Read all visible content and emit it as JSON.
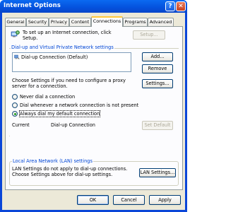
{
  "window": {
    "title": "Internet Options",
    "help_glyph": "?",
    "close_glyph": "✕"
  },
  "tabs": [
    {
      "label": "General"
    },
    {
      "label": "Security"
    },
    {
      "label": "Privacy"
    },
    {
      "label": "Content"
    },
    {
      "label": "Connections",
      "active": true
    },
    {
      "label": "Programs"
    },
    {
      "label": "Advanced"
    }
  ],
  "setup": {
    "text": "To set up an Internet connection, click Setup.",
    "text_line1": "To set up an Internet connection, click",
    "text_line2": "Setup.",
    "button": "Setup..."
  },
  "dialup": {
    "group_title": "Dial-up and Virtual Private Network settings",
    "connections": [
      "Dial-up Connection (Default)"
    ],
    "add_button": "Add...",
    "remove_button": "Remove",
    "proxy_text_line1": "Choose Settings if you need to configure a proxy",
    "proxy_text_line2": "server for a connection.",
    "settings_button": "Settings...",
    "radio_never": "Never dial a connection",
    "radio_whenever": "Dial whenever a network connection is not present",
    "radio_always": "Always dial my default connection",
    "selected_option": "Always dial my default connection",
    "current_label": "Current",
    "current_value": "Dial-up Connection",
    "set_default_button": "Set Default"
  },
  "lan": {
    "group_title": "Local Area Network (LAN) settings",
    "text_line1": "LAN Settings do not apply to dial-up connections.",
    "text_line2": "Choose Settings above for dial-up settings.",
    "button": "LAN Settings..."
  },
  "footer": {
    "ok": "OK",
    "cancel": "Cancel",
    "apply": "Apply"
  },
  "colors": {
    "title_bar": "#0451dd",
    "group_title": "#0046d5",
    "dialog_face": "#ece9d8",
    "active_tab_accent": "#ffc83c"
  }
}
